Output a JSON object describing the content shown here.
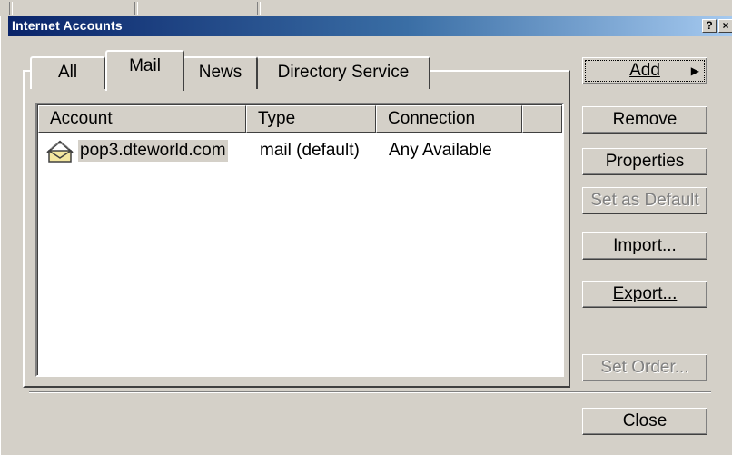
{
  "window": {
    "title": "Internet Accounts",
    "help_glyph": "?",
    "close_glyph": "×"
  },
  "tabs": [
    {
      "label": "All",
      "selected": false
    },
    {
      "label": "Mail",
      "selected": true
    },
    {
      "label": "News",
      "selected": false
    },
    {
      "label": "Directory Service",
      "selected": false
    }
  ],
  "list": {
    "columns": [
      "Account",
      "Type",
      "Connection",
      ""
    ],
    "rows": [
      {
        "account": "pop3.dteworld.com",
        "type": "mail (default)",
        "connection": "Any Available",
        "icon": "mail-account-icon"
      }
    ]
  },
  "buttons": {
    "add": "Add",
    "remove": "Remove",
    "properties": "Properties",
    "set_default": "Set as Default",
    "import": "Import...",
    "export": "Export...",
    "set_order": "Set Order...",
    "close": "Close"
  },
  "colors": {
    "titlebar_start": "#0a246a",
    "titlebar_end": "#a6caf0",
    "face": "#d4d0c8"
  }
}
